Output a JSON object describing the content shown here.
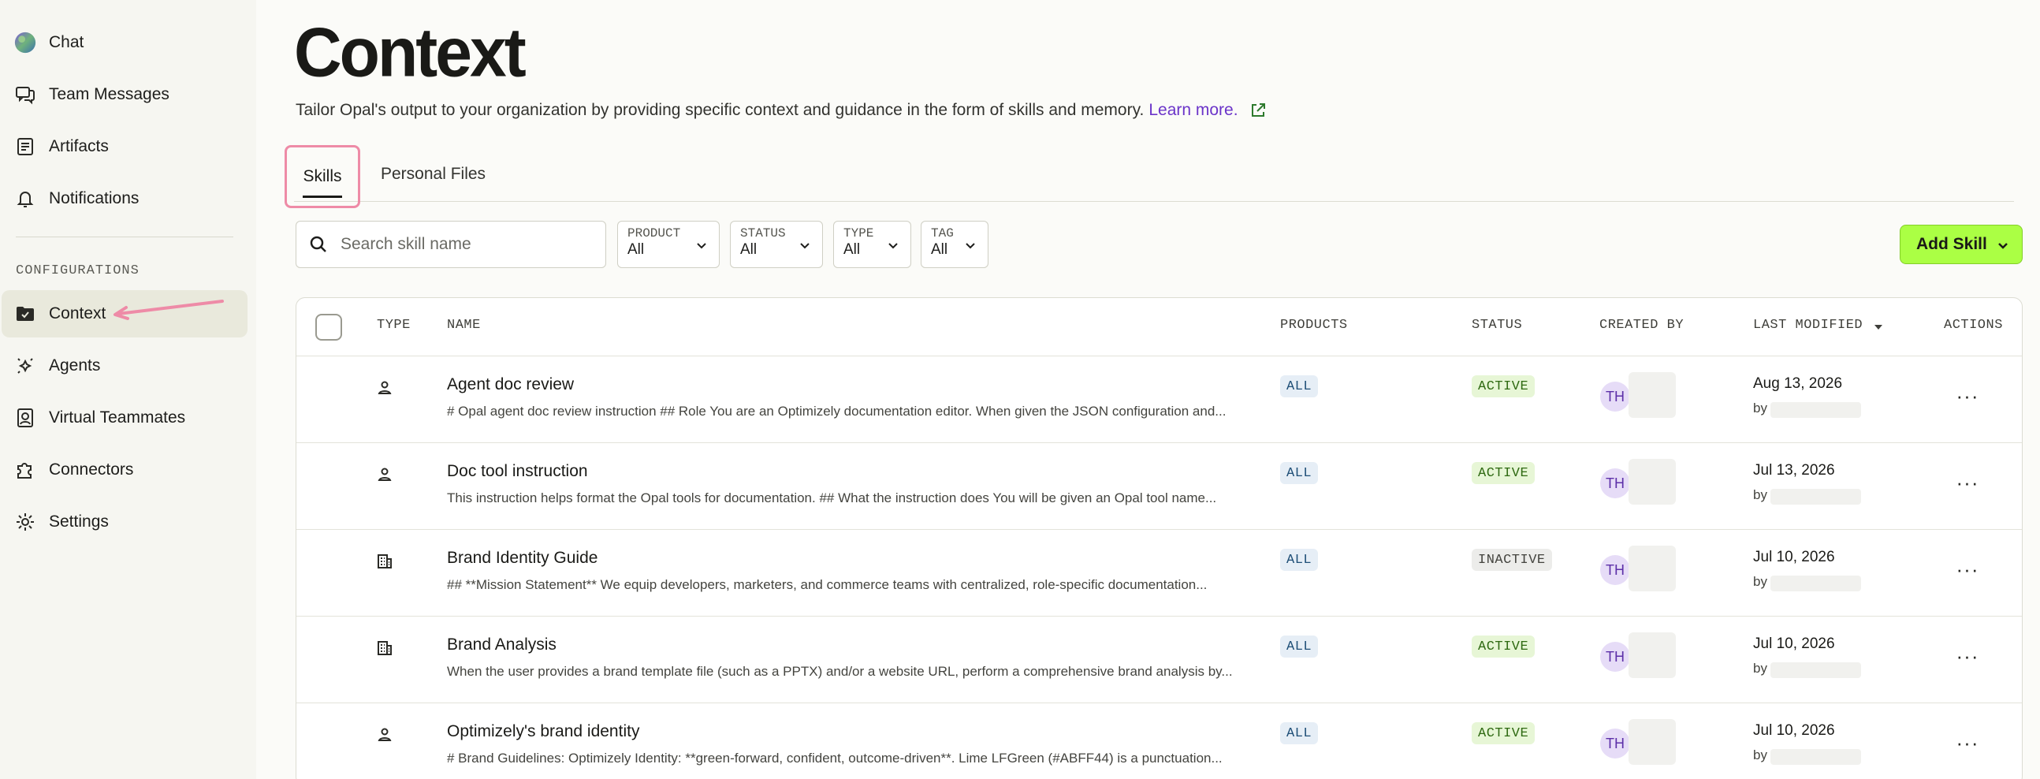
{
  "sidebar": {
    "items": [
      {
        "label": "Chat",
        "icon": "globe-avatar-icon"
      },
      {
        "label": "Team Messages",
        "icon": "chat-bubbles-icon"
      },
      {
        "label": "Artifacts",
        "icon": "document-list-icon"
      },
      {
        "label": "Notifications",
        "icon": "bell-icon"
      }
    ],
    "section_label": "CONFIGURATIONS",
    "config_items": [
      {
        "label": "Context",
        "icon": "folder-check-icon",
        "active": true
      },
      {
        "label": "Agents",
        "icon": "sparkle-icon"
      },
      {
        "label": "Virtual Teammates",
        "icon": "person-badge-icon"
      },
      {
        "label": "Connectors",
        "icon": "puzzle-icon"
      },
      {
        "label": "Settings",
        "icon": "gear-icon"
      }
    ]
  },
  "page": {
    "title": "Context",
    "description": "Tailor Opal's output to your organization by providing specific context and guidance in the form of skills and memory.",
    "learn_more": "Learn more."
  },
  "tabs": [
    {
      "label": "Skills",
      "active": true
    },
    {
      "label": "Personal Files",
      "active": false
    }
  ],
  "filters": {
    "search_placeholder": "Search skill name",
    "product": {
      "label": "PRODUCT",
      "value": "All"
    },
    "status": {
      "label": "STATUS",
      "value": "All"
    },
    "type": {
      "label": "TYPE",
      "value": "All"
    },
    "tag": {
      "label": "TAG",
      "value": "All"
    }
  },
  "add_button": "Add Skill",
  "table": {
    "columns": {
      "type": "TYPE",
      "name": "NAME",
      "products": "PRODUCTS",
      "status": "STATUS",
      "created_by": "CREATED BY",
      "last_modified": "LAST MODIFIED",
      "actions": "ACTIONS"
    },
    "rows": [
      {
        "type_icon": "person-icon",
        "name": "Agent doc review",
        "description": "# Opal agent doc review instruction ## Role You are an Optimizely documentation editor. When given the JSON configuration and...",
        "product": "ALL",
        "status": "ACTIVE",
        "creator_initials": "TH",
        "date": "Aug 13, 2026",
        "by": "by"
      },
      {
        "type_icon": "person-icon",
        "name": "Doc tool instruction",
        "description": "This instruction helps format the Opal tools for documentation. ## What the instruction does You will be given an Opal tool name...",
        "product": "ALL",
        "status": "ACTIVE",
        "creator_initials": "TH",
        "date": "Jul 13, 2026",
        "by": "by"
      },
      {
        "type_icon": "building-icon",
        "name": "Brand Identity Guide",
        "description": "## **Mission Statement** We equip developers, marketers, and commerce teams with centralized, role-specific documentation...",
        "product": "ALL",
        "status": "INACTIVE",
        "creator_initials": "TH",
        "date": "Jul 10, 2026",
        "by": "by"
      },
      {
        "type_icon": "building-icon",
        "name": "Brand Analysis",
        "description": "When the user provides a brand template file (such as a PPTX) and/or a website URL, perform a comprehensive brand analysis by...",
        "product": "ALL",
        "status": "ACTIVE",
        "creator_initials": "TH",
        "date": "Jul 10, 2026",
        "by": "by"
      },
      {
        "type_icon": "person-icon",
        "name": "Optimizely's brand identity",
        "description": "# Brand Guidelines: Optimizely Identity: **green-forward, confident, outcome-driven**. Lime LFGreen (#ABFF44) is a punctuation...",
        "product": "ALL",
        "status": "ACTIVE",
        "creator_initials": "TH",
        "date": "Jul 10, 2026",
        "by": "by"
      }
    ]
  },
  "colors": {
    "accent_lime": "#abff44",
    "link_purple": "#6b34c9",
    "highlight_pink": "#ee8ba7"
  }
}
